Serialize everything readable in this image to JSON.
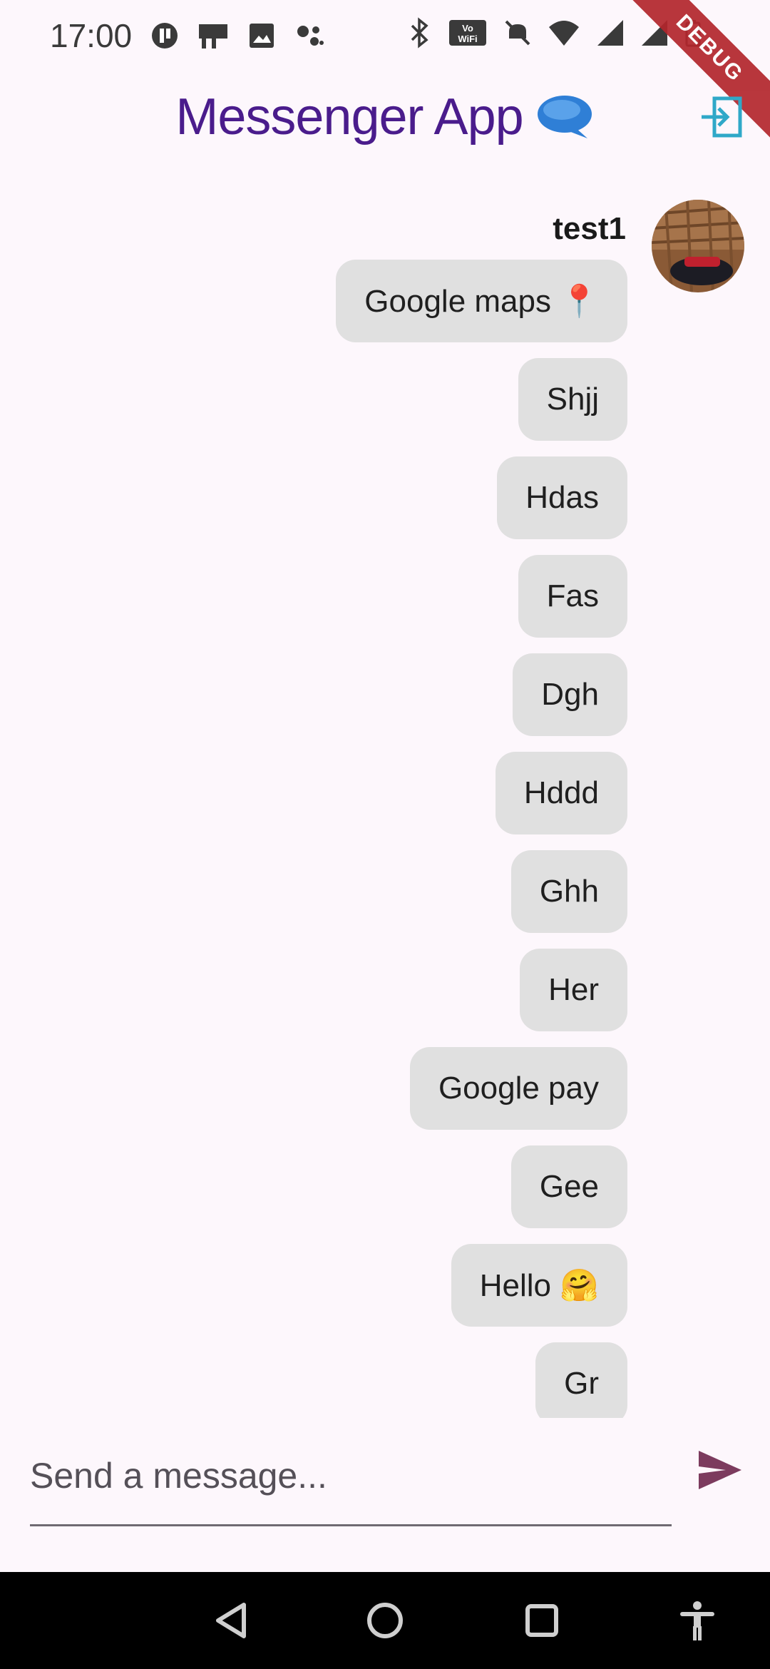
{
  "status_bar": {
    "time": "17:00"
  },
  "debug_banner": "DEBUG",
  "app_bar": {
    "title": "Messenger App",
    "title_emoji": "🗨️"
  },
  "chat": {
    "sender": "test1",
    "messages": [
      "Google maps 📍",
      "Shjj",
      "Hdas",
      "Fas",
      "Dgh",
      "Hddd",
      "Ghh",
      "Her",
      "Google pay",
      "Gee",
      "Hello 🤗",
      "Gr"
    ]
  },
  "composer": {
    "placeholder": "Send a message...",
    "value": ""
  },
  "colors": {
    "title": "#4a1c8c",
    "send": "#7c3b5e",
    "logout": "#2fa8c8",
    "bubble": "#e0e0e0"
  }
}
